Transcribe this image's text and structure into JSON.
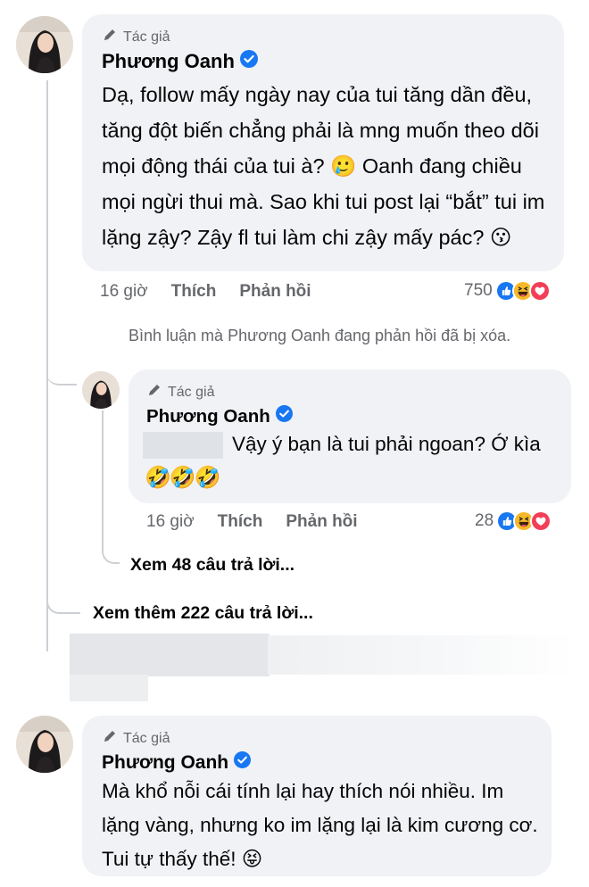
{
  "comments": [
    {
      "author_tag": "Tác giả",
      "author": "Phương Oanh",
      "text": "Dạ, follow mấy ngày nay của tui tăng dần đều, tăng đột biến chẳng phải là mng muốn theo dõi mọi động thái của tui à? 🥲 Oanh đang chiều mọi ngừi thui mà. Sao khi tui post lại “bắt” tui im lặng zậy? Zậy fl tui làm chi zậy mấy pác? 😗",
      "time": "16 giờ",
      "like_label": "Thích",
      "reply_label": "Phản hồi",
      "reaction_count": "750",
      "reactions": [
        "like-icon",
        "haha-icon",
        "love-icon"
      ]
    },
    {
      "author_tag": "Tác giả",
      "author": "Phương Oanh",
      "text": "Mà khổ nỗi cái tính lại hay thích nói nhiều. Im lặng vàng, nhưng ko im lặng lại là kim cương cơ. Tui tự thấy thế! 😝"
    }
  ],
  "deleted_note": "Bình luận mà Phương Oanh đang phản hồi đã bị xóa.",
  "reply": {
    "author_tag": "Tác giả",
    "author": "Phương Oanh",
    "text": "Vậy ý bạn là tui phải ngoan? Ớ kìa",
    "emojis": "🤣🤣🤣",
    "time": "16 giờ",
    "like_label": "Thích",
    "reply_label": "Phản hồi",
    "reaction_count": "28",
    "reactions": [
      "like-icon",
      "haha-icon",
      "love-icon"
    ]
  },
  "view_replies": "Xem 48 câu trả lời...",
  "view_more_replies": "Xem thêm 222 câu trả lời...",
  "colors": {
    "bubble": "#f0f2f5",
    "muted": "#65676b",
    "verified": "#1877f2",
    "like": "#1877f2",
    "haha": "#f7b928",
    "love": "#f33e58"
  }
}
